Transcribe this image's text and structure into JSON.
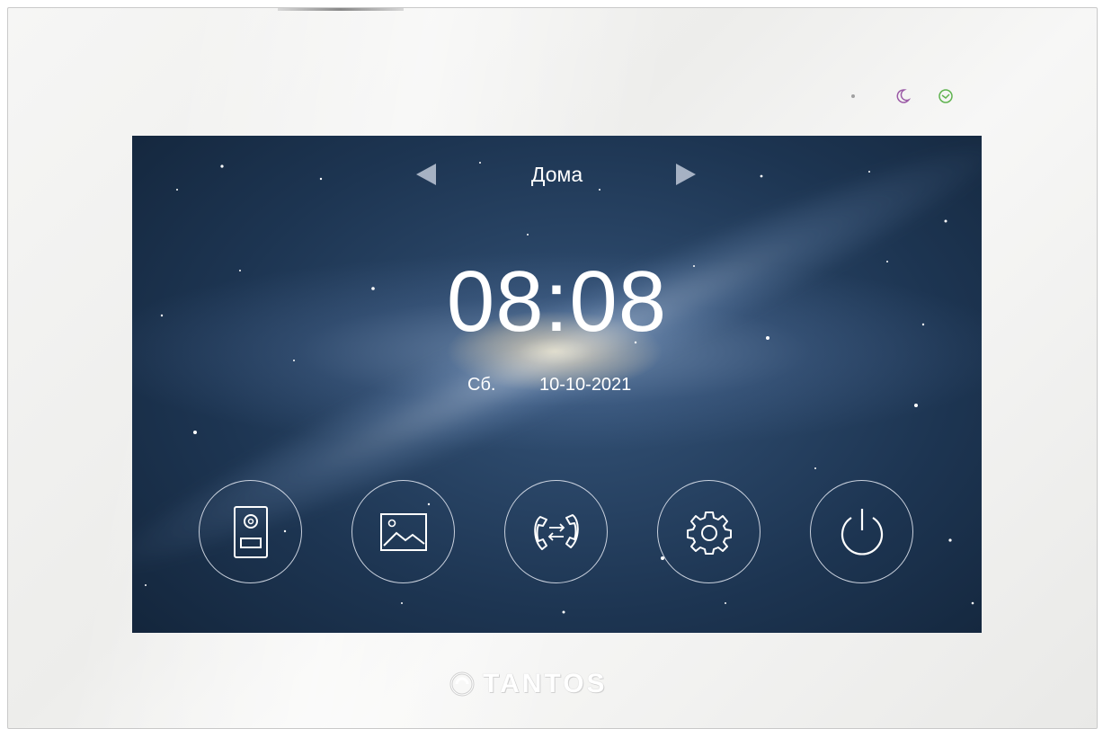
{
  "header": {
    "location_label": "Дома"
  },
  "status": {
    "time": "08:08",
    "weekday": "Сб.",
    "date": "10-10-2021"
  },
  "indicators": [
    "dot-icon",
    "moon-icon",
    "clock-icon"
  ],
  "menu": {
    "buttons": [
      {
        "icon": "door-panel-icon"
      },
      {
        "icon": "image-gallery-icon"
      },
      {
        "icon": "intercom-call-icon"
      },
      {
        "icon": "gear-icon"
      },
      {
        "icon": "power-icon"
      }
    ]
  },
  "brand": {
    "logo_text": "TANTOS"
  },
  "colors": {
    "moon_indicator": "#9b5aa6",
    "clock_indicator": "#5fb34f",
    "screen_background": "#1d3552"
  }
}
